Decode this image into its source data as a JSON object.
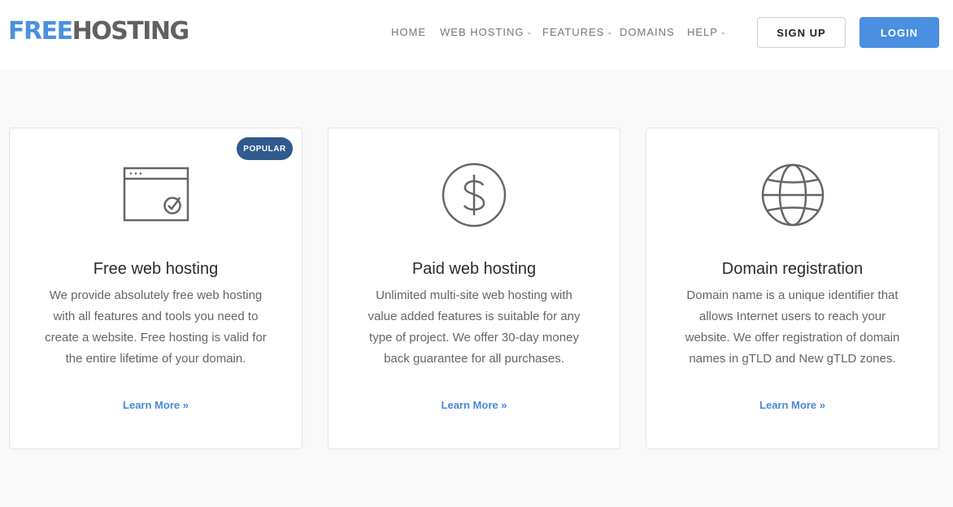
{
  "brand": {
    "part1": "FREE",
    "part2": "HOSTING",
    "color_primary": "#4a90e2",
    "color_secondary": "#616161"
  },
  "nav": {
    "items": [
      {
        "label": "HOME",
        "has_dropdown": false
      },
      {
        "label": "WEB HOSTING",
        "has_dropdown": true
      },
      {
        "label": "FEATURES",
        "has_dropdown": true
      },
      {
        "label": "DOMAINS",
        "has_dropdown": false
      },
      {
        "label": "HELP",
        "has_dropdown": true
      }
    ],
    "signup_label": "SIGN UP",
    "login_label": "LOGIN",
    "accent_color": "#4a8fe2"
  },
  "cards": [
    {
      "badge": "POPULAR",
      "icon": "browser-check-icon",
      "title": "Free web hosting",
      "description": "We provide absolutely free web hosting with all features and tools you need to create a website. Free hosting is valid for the entire lifetime of your domain.",
      "link": "Learn More »"
    },
    {
      "icon": "dollar-icon",
      "title": "Paid web hosting",
      "description": "Unlimited multi-site web hosting with value added features is suitable for any type of project. We offer 30-day money back guarantee for all purchases.",
      "link": "Learn More »"
    },
    {
      "icon": "globe-icon",
      "title": "Domain registration",
      "description": "Domain name is a unique identifier that allows Internet users to reach your website. We offer registration of domain names in gTLD and New gTLD zones.",
      "link": "Learn More »"
    }
  ]
}
